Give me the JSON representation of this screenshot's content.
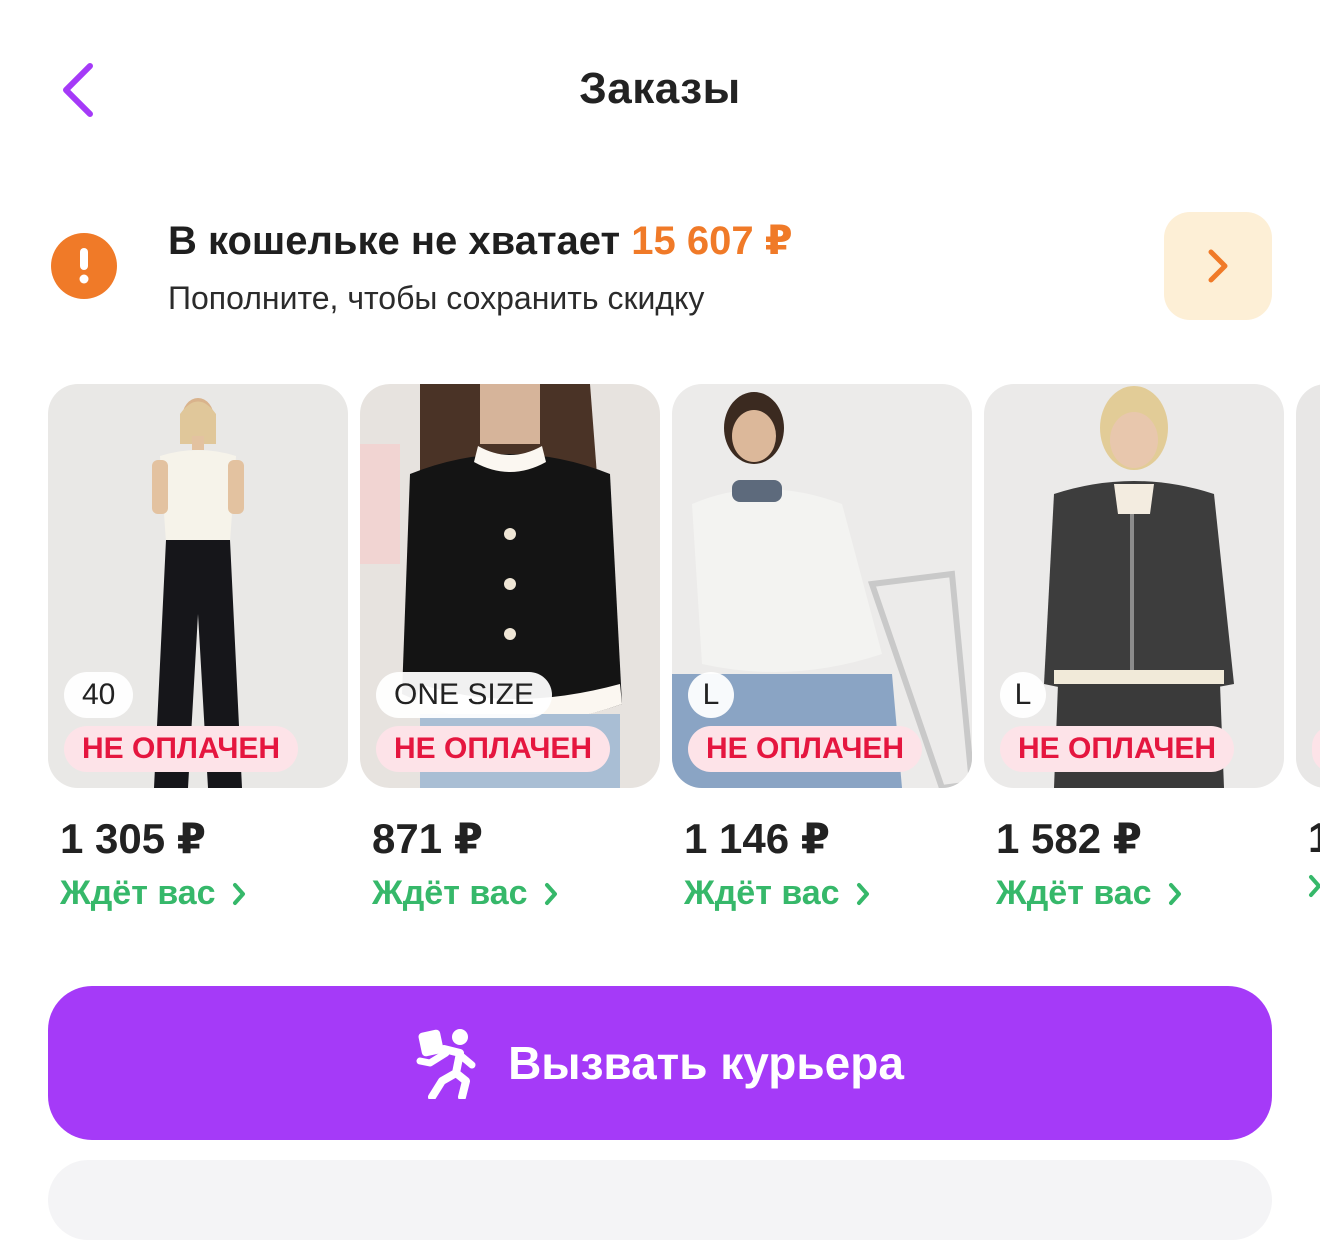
{
  "header": {
    "title": "Заказы",
    "back_icon": "chevron-left-icon",
    "accent_color": "#a53af8"
  },
  "wallet": {
    "title_prefix": "В кошельке не хватает ",
    "amount": "15 607 ₽",
    "subtitle": "Пополните, чтобы сохранить скидку",
    "alert_icon": "exclamation-icon",
    "amount_color": "#f07a28"
  },
  "orders": [
    {
      "size": "40",
      "status": "НЕ ОПЛАЧЕН",
      "price": "1 305 ₽",
      "state": "Ждёт вас"
    },
    {
      "size": "ONE SIZE",
      "status": "НЕ ОПЛАЧЕН",
      "price": "871 ₽",
      "state": "Ждёт вас"
    },
    {
      "size": "L",
      "status": "НЕ ОПЛАЧЕН",
      "price": "1 146 ₽",
      "state": "Ждёт вас"
    },
    {
      "size": "L",
      "status": "НЕ ОПЛАЧЕН",
      "price": "1 582 ₽",
      "state": "Ждёт вас"
    }
  ],
  "courier_button": {
    "label": "Вызвать курьера",
    "icon": "running-courier-icon",
    "color": "#a53af8"
  },
  "status_colors": {
    "unpaid_text": "#e5163f",
    "unpaid_bg": "#fde3e8",
    "waiting": "#36b86a"
  }
}
